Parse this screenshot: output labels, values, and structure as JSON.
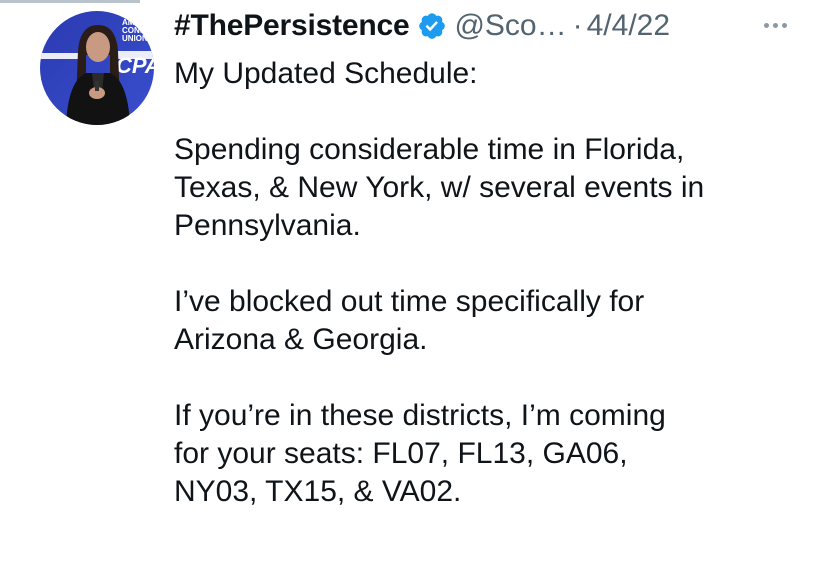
{
  "tweet": {
    "display_name": "#ThePersistence",
    "handle": "@Sco…",
    "separator": "·",
    "date": "4/4/22",
    "lines": {
      "l1": "My Updated Schedule:",
      "l2": "Spending considerable time in Florida,",
      "l3": "Texas, & New York, w/ several events in",
      "l4": "Pennsylvania.",
      "l5": "I’ve blocked out time specifically for",
      "l6": "Arizona & Georgia.",
      "l7": "If you’re in these districts, I’m coming",
      "l8": "for your seats: FL07, FL13, GA06,",
      "l9": "NY03, TX15, & VA02."
    },
    "avatar_backdrop_text": {
      "line1": "AMER",
      "line2": "CONSE",
      "line3": "UNION",
      "logo": "CPA"
    }
  },
  "icons": {
    "verified": "verified-badge-icon",
    "more": "more-icon"
  },
  "colors": {
    "text": "#0f1419",
    "secondary": "#536471",
    "verified": "#1d9bf0",
    "avatar_bg": "#2f3fb8"
  }
}
